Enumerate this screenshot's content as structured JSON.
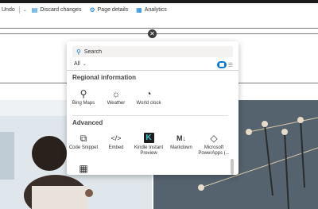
{
  "toolbar": {
    "undo_label": "Undo",
    "discard_label": "Discard changes",
    "page_details_label": "Page details",
    "analytics_label": "Analytics"
  },
  "picker": {
    "search_placeholder": "Search",
    "filter_label": "All",
    "sections": [
      {
        "title": "Regional information",
        "items": [
          {
            "label": "Bing Maps",
            "icon": "map-pin-icon",
            "glyph": "⚲"
          },
          {
            "label": "Weather",
            "icon": "weather-icon",
            "glyph": "☼"
          },
          {
            "label": "World clock",
            "icon": "world-clock-icon",
            "glyph": "◔"
          }
        ]
      },
      {
        "title": "Advanced",
        "items": [
          {
            "label": "Code Snippet",
            "icon": "code-snippet-icon",
            "glyph": "⧉"
          },
          {
            "label": "Embed",
            "icon": "embed-icon",
            "glyph": "</>"
          },
          {
            "label": "Kindle Instant Preview",
            "icon": "kindle-icon",
            "glyph": "K"
          },
          {
            "label": "Markdown",
            "icon": "markdown-icon",
            "glyph": "M↓"
          },
          {
            "label": "Microsoft PowerApps (...",
            "icon": "powerapps-icon",
            "glyph": "◇"
          },
          {
            "label": "",
            "icon": "office-building-icon",
            "glyph": "▦"
          }
        ]
      }
    ]
  },
  "colors": {
    "accent": "#0078d4",
    "topbar": "#1b1b1b",
    "panel_bg": "#ffffff"
  }
}
